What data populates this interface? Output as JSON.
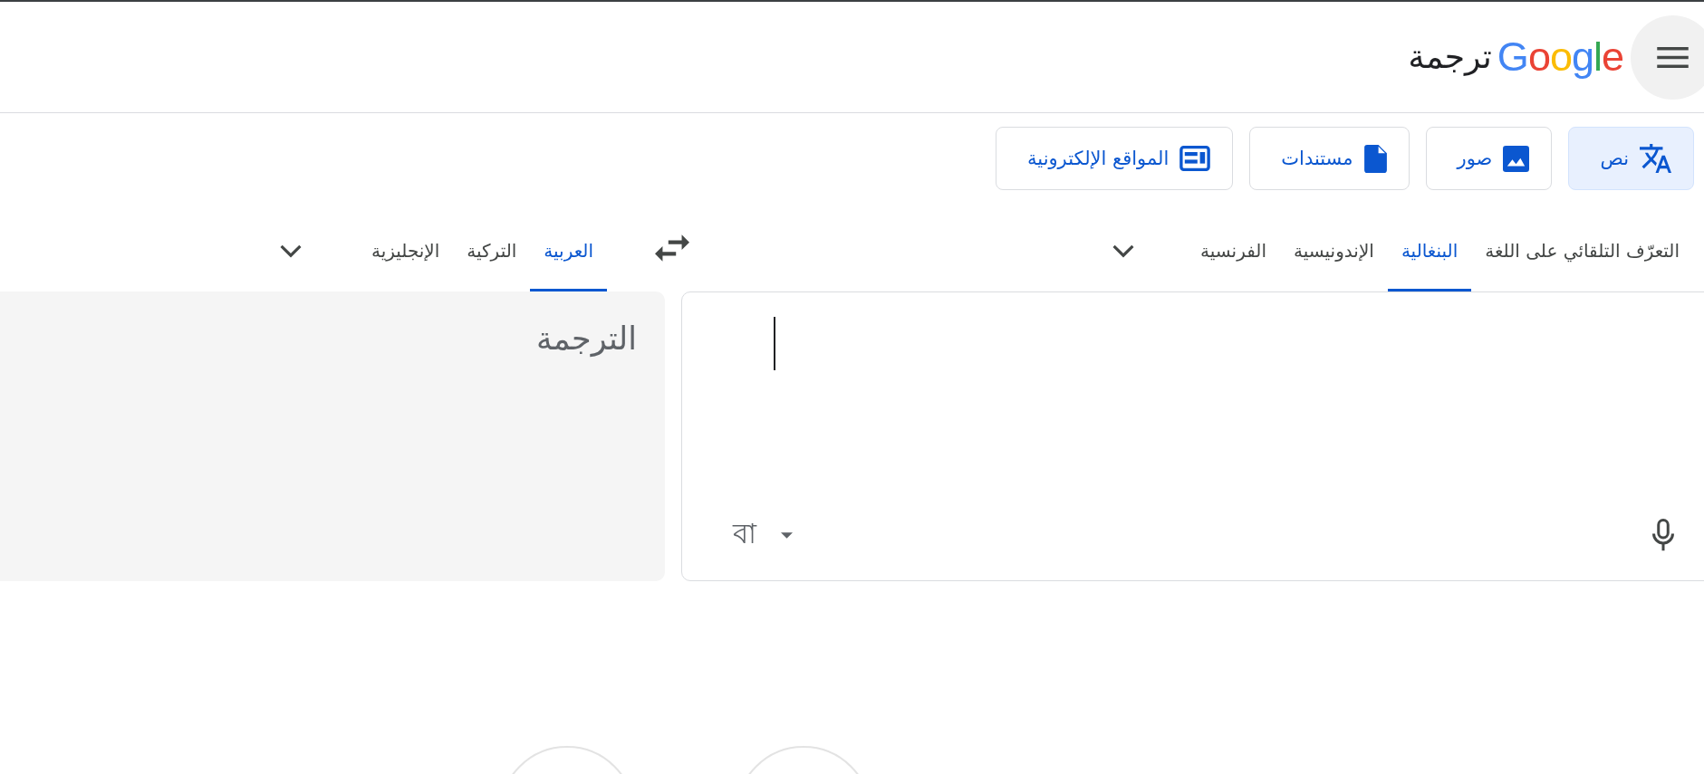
{
  "header": {
    "logo": "Google",
    "product": "ترجمة"
  },
  "modes": [
    {
      "kind": "text",
      "label": "نص",
      "selected": true
    },
    {
      "kind": "images",
      "label": "صور",
      "selected": false
    },
    {
      "kind": "documents",
      "label": "مستندات",
      "selected": false
    },
    {
      "kind": "websites",
      "label": "المواقع الإلكترونية",
      "selected": false
    }
  ],
  "source_languages": [
    {
      "label": "التعرّف التلقائي على اللغة",
      "selected": false
    },
    {
      "label": "البنغالية",
      "selected": true
    },
    {
      "label": "الإندونيسية",
      "selected": false
    },
    {
      "label": "الفرنسية",
      "selected": false
    }
  ],
  "target_languages": [
    {
      "label": "العربية",
      "selected": true
    },
    {
      "label": "التركية",
      "selected": false
    },
    {
      "label": "الإنجليزية",
      "selected": false
    }
  ],
  "source_panel": {
    "focused": true,
    "input_tool": "বা"
  },
  "translation_panel": {
    "placeholder": "الترجمة"
  }
}
